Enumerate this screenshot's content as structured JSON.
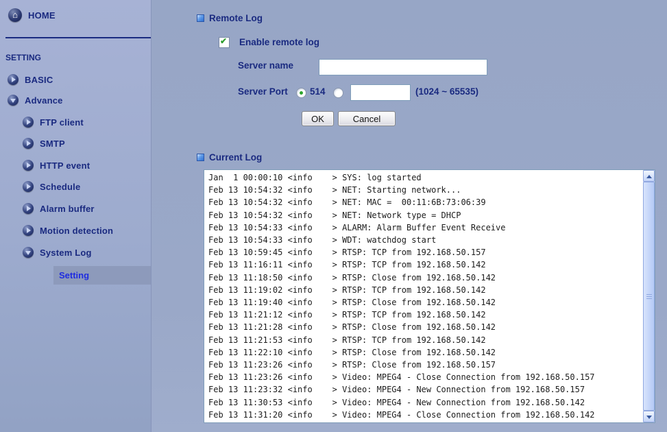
{
  "sidebar": {
    "home_label": "HOME",
    "section_label": "SETTING",
    "items": [
      {
        "label": "BASIC",
        "state": "collapsed",
        "level": 1
      },
      {
        "label": "Advance",
        "state": "expanded",
        "level": 1
      },
      {
        "label": "FTP client",
        "state": "collapsed",
        "level": 2
      },
      {
        "label": "SMTP",
        "state": "collapsed",
        "level": 2
      },
      {
        "label": "HTTP event",
        "state": "collapsed",
        "level": 2
      },
      {
        "label": "Schedule",
        "state": "collapsed",
        "level": 2
      },
      {
        "label": "Alarm buffer",
        "state": "collapsed",
        "level": 2
      },
      {
        "label": "Motion detection",
        "state": "collapsed",
        "level": 2
      },
      {
        "label": "System Log",
        "state": "expanded",
        "level": 2
      },
      {
        "label": "Setting",
        "state": "active",
        "level": 3
      }
    ]
  },
  "remote_log": {
    "title": "Remote Log",
    "enable_label": "Enable remote log",
    "enable_checked": true,
    "server_name_label": "Server name",
    "server_name_value": "",
    "server_port_label": "Server Port",
    "port_default_value": "514",
    "port_selected": "default",
    "port_custom_value": "",
    "port_range_hint": "(1024 ~ 65535)",
    "ok_label": "OK",
    "cancel_label": "Cancel"
  },
  "current_log": {
    "title": "Current Log",
    "lines": [
      "Jan  1 00:00:10 <info    > SYS: log started",
      "Feb 13 10:54:32 <info    > NET: Starting network...",
      "Feb 13 10:54:32 <info    > NET: MAC =  00:11:6B:73:06:39",
      "Feb 13 10:54:32 <info    > NET: Network type = DHCP",
      "Feb 13 10:54:33 <info    > ALARM: Alarm Buffer Event Receive",
      "Feb 13 10:54:33 <info    > WDT: watchdog start",
      "Feb 13 10:59:45 <info    > RTSP: TCP from 192.168.50.157",
      "Feb 13 11:16:11 <info    > RTSP: TCP from 192.168.50.142",
      "Feb 13 11:18:50 <info    > RTSP: Close from 192.168.50.142",
      "Feb 13 11:19:02 <info    > RTSP: TCP from 192.168.50.142",
      "Feb 13 11:19:40 <info    > RTSP: Close from 192.168.50.142",
      "Feb 13 11:21:12 <info    > RTSP: TCP from 192.168.50.142",
      "Feb 13 11:21:28 <info    > RTSP: Close from 192.168.50.142",
      "Feb 13 11:21:53 <info    > RTSP: TCP from 192.168.50.142",
      "Feb 13 11:22:10 <info    > RTSP: Close from 192.168.50.142",
      "Feb 13 11:23:26 <info    > RTSP: Close from 192.168.50.157",
      "Feb 13 11:23:26 <info    > Video: MPEG4 - Close Connection from 192.168.50.157",
      "Feb 13 11:23:32 <info    > Video: MPEG4 - New Connection from 192.168.50.157",
      "Feb 13 11:30:53 <info    > Video: MPEG4 - New Connection from 192.168.50.142",
      "Feb 13 11:31:20 <info    > Video: MPEG4 - Close Connection from 192.168.50.142"
    ]
  },
  "colors": {
    "sidebar_bg": "#9dabce",
    "main_bg": "#9aa8c8",
    "nav_text": "#1a2a80",
    "active_item_bg": "#8d9abb",
    "active_item_text": "#1f2ce0",
    "bullet_blue": "#2f6fd0",
    "check_green": "#2f9e2f"
  }
}
